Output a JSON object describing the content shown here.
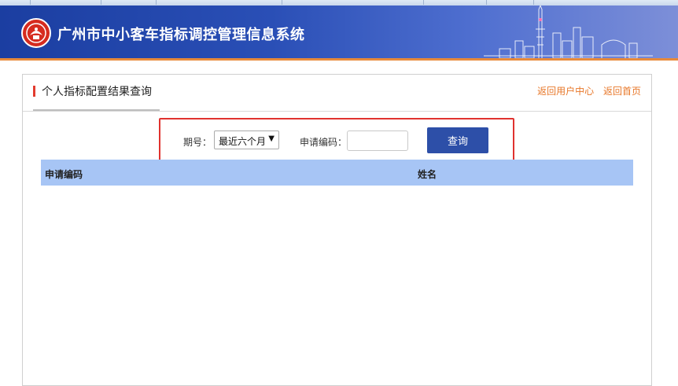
{
  "header": {
    "title": "广州市中小客车指标调控管理信息系统",
    "logo_icon": "emblem-icon",
    "banner_color": "#2a4fb6",
    "accent_color": "#e88a3a"
  },
  "panel": {
    "title": "个人指标配置结果查询",
    "links": {
      "user_center": "返回用户中心",
      "home": "返回首页"
    }
  },
  "search": {
    "period_label": "期号：",
    "period_value": "最近六个月",
    "code_label": "申请编码：",
    "code_value": "",
    "query_button": "查询"
  },
  "table": {
    "columns": [
      "申请编码",
      "姓名"
    ],
    "header_color": "#a7c5f5",
    "rows": []
  }
}
